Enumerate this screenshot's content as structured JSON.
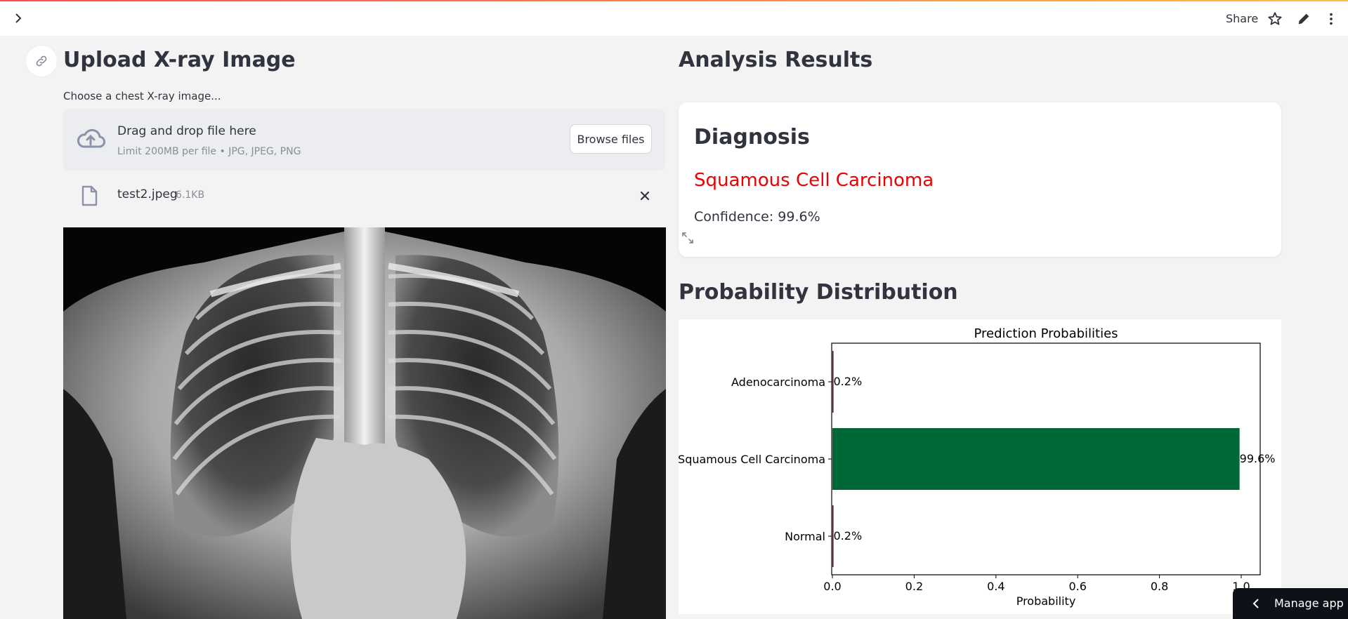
{
  "header": {
    "share_label": "Share",
    "icons": [
      "chevron-right-icon",
      "star-icon",
      "pencil-icon",
      "more-vertical-icon"
    ]
  },
  "upload": {
    "title": "Upload X-ray Image",
    "input_label": "Choose a chest X-ray image...",
    "dropzone_title": "Drag and drop file here",
    "dropzone_limit": "Limit 200MB per file • JPG, JPEG, PNG",
    "browse_label": "Browse files",
    "file": {
      "name": "test2.jpeg",
      "size": "6.1KB"
    }
  },
  "analysis": {
    "title": "Analysis Results",
    "diagnosis_title": "Diagnosis",
    "diagnosis_value": "Squamous Cell Carcinoma",
    "confidence": "Confidence: 99.6%",
    "diagnosis_color": "#ee0000"
  },
  "probability": {
    "title": "Probability Distribution"
  },
  "chart_data": {
    "type": "bar",
    "orientation": "horizontal",
    "title": "Prediction Probabilities",
    "xlabel": "Probability",
    "ylabel": "",
    "categories": [
      "Adenocarcinoma",
      "Squamous Cell Carcinoma",
      "Normal"
    ],
    "values": [
      0.002,
      0.996,
      0.002
    ],
    "value_labels": [
      "0.2%",
      "99.6%",
      "0.2%"
    ],
    "colors": [
      "#67001f",
      "#006837",
      "#67001f"
    ],
    "xlim": [
      0,
      1.0
    ],
    "xticks": [
      "0.0",
      "0.2",
      "0.4",
      "0.6",
      "0.8",
      "1.0"
    ],
    "grid": false
  },
  "manage_app": {
    "label": "Manage app"
  }
}
